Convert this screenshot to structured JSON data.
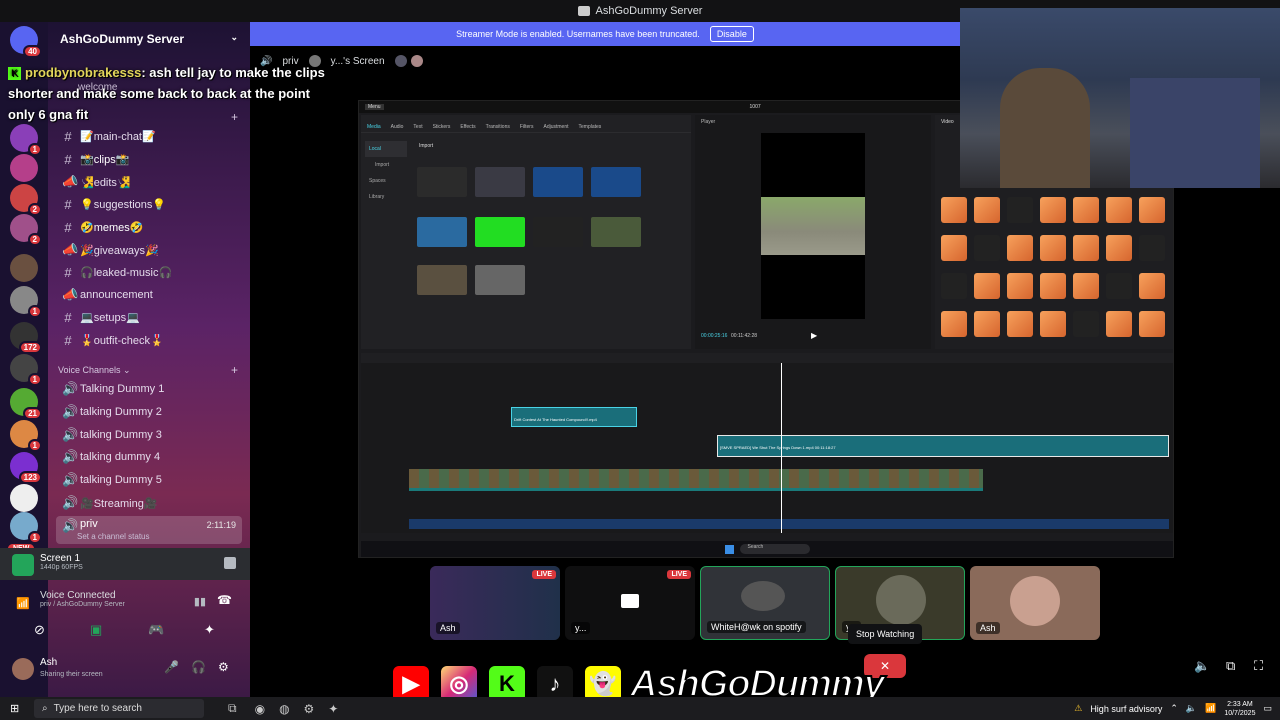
{
  "window": {
    "title": "AshGoDummy Server"
  },
  "banner": {
    "text": "Streamer Mode is enabled. Usernames have been truncated.",
    "button": "Disable"
  },
  "servers": {
    "badges": [
      "40",
      "1",
      "1",
      "2",
      "2",
      "1",
      "172",
      "1",
      "21",
      "1",
      "123",
      "1"
    ],
    "new_label": "NEW"
  },
  "sidebar": {
    "server_name": "AshGoDummy Server",
    "welcome": "welcome",
    "channels": [
      {
        "name": "📝main-chat📝"
      },
      {
        "name": "📸clips📸"
      },
      {
        "name": "🧏‍♂️edits🧏‍♂️"
      },
      {
        "name": "💡suggestions💡"
      },
      {
        "name": "🤣memes🤣"
      },
      {
        "name": "🎉giveaways🎉"
      },
      {
        "name": "🎧leaked-music🎧"
      },
      {
        "name": "announcement"
      },
      {
        "name": "💻setups💻"
      },
      {
        "name": "🎖️outfit-check🎖️"
      }
    ],
    "voice_category": "Voice Channels",
    "voice_channels": [
      {
        "name": "Talking Dummy 1"
      },
      {
        "name": "talking Dummy 2"
      },
      {
        "name": "talking Dummy 3"
      },
      {
        "name": "talking dummy 4"
      },
      {
        "name": "talking Dummy 5"
      },
      {
        "name": "🎥Streaming🎥"
      }
    ],
    "active_channel": {
      "name": "priv",
      "time": "2:11:19",
      "status": "Set a channel status"
    }
  },
  "chat_overlay": {
    "user": "prodbynobrakesss",
    "message": ": ash tell jay to make the clips shorter and make some back to back at the point only 6 gna fit"
  },
  "screen_panel": {
    "title": "Screen 1",
    "quality": "1440p 60FPS"
  },
  "voice_panel": {
    "title": "Voice Connected",
    "location": "priv / AshGoDummy Server"
  },
  "user_panel": {
    "name": "Ash",
    "status": "Sharing their screen"
  },
  "stage": {
    "channel": "priv",
    "screen_label": "y...'s Screen"
  },
  "capcut": {
    "menu": "Menu",
    "project": "1007",
    "tabs": [
      "Media",
      "Audio",
      "Text",
      "Stickers",
      "Effects",
      "Transitions",
      "Filters",
      "Adjustment",
      "Templates"
    ],
    "side": [
      "Local",
      "Import",
      "Spaces",
      "Library"
    ],
    "import": "Import",
    "player_label": "Player",
    "timecode": "00:00:25:16",
    "duration": "00:11:42:28",
    "video_label": "Video",
    "clip1": "Drift Contest At The Haunted Compound!!.mp4",
    "clip2": "[SMVE SPRAED] We Shut The Springs Down 1.mp4  00:11:18:27",
    "search": "Search"
  },
  "tiles": [
    {
      "label": "Ash",
      "live": "LIVE"
    },
    {
      "label": "y...",
      "live": "LIVE"
    },
    {
      "label": "WhiteH@wk on spotify"
    },
    {
      "label": "y..."
    },
    {
      "label": "Ash"
    }
  ],
  "tooltip": "Stop Watching",
  "brand": "AshGoDummy",
  "taskbar": {
    "search": "Type here to search",
    "weather": "High surf advisory",
    "time": "2:33 AM",
    "date": "10/7/2025"
  },
  "colors": {
    "blurple": "#5865f2",
    "red": "#da373c",
    "green": "#23a55a"
  }
}
